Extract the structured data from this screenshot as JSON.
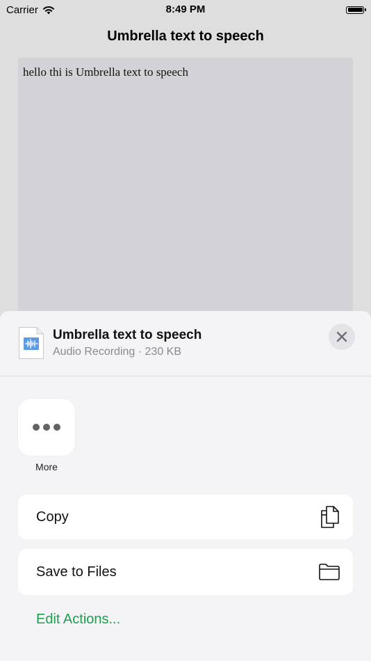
{
  "status_bar": {
    "carrier": "Carrier",
    "time": "8:49 PM"
  },
  "nav": {
    "title": "Umbrella text to speech"
  },
  "editor": {
    "text": "hello thi is Umbrella text to speech"
  },
  "share_sheet": {
    "file_title": "Umbrella text to speech",
    "file_subtitle": "Audio Recording · 230 KB",
    "more_label": "More",
    "actions": [
      {
        "label": "Copy",
        "icon": "copy-icon"
      },
      {
        "label": "Save to Files",
        "icon": "folder-icon"
      }
    ],
    "edit_actions_label": "Edit Actions...",
    "accent_color": "#1f9d4f"
  }
}
